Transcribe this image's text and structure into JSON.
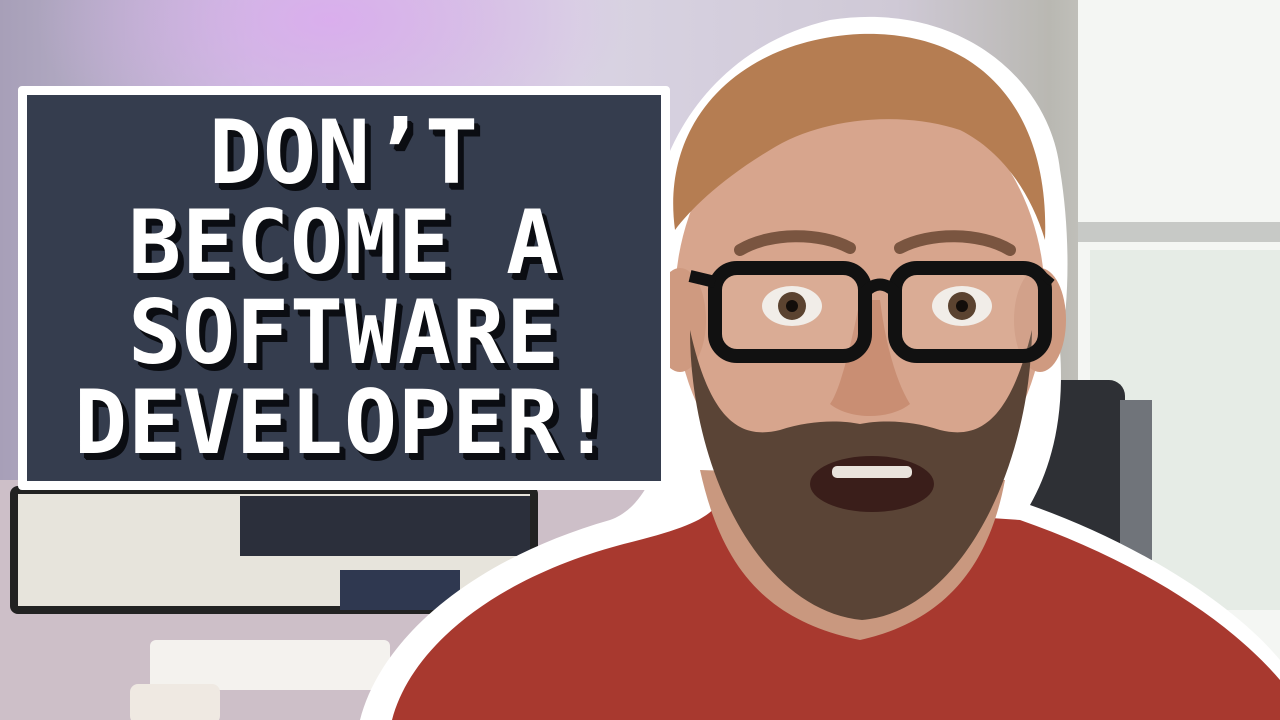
{
  "thumbnail": {
    "headline_lines": [
      "DON’T",
      "BECOME A",
      "SOFTWARE",
      "DEVELOPER!"
    ]
  },
  "colors": {
    "caption_background": "#353d4e",
    "caption_border": "#ffffff",
    "caption_text": "#ffffff",
    "caption_text_shadow": "#0b0d12",
    "shirt": "#a8392f",
    "beard": "#5a4436",
    "hair": "#b57d52",
    "glasses_frame": "#111111",
    "person_outline": "#ffffff"
  }
}
